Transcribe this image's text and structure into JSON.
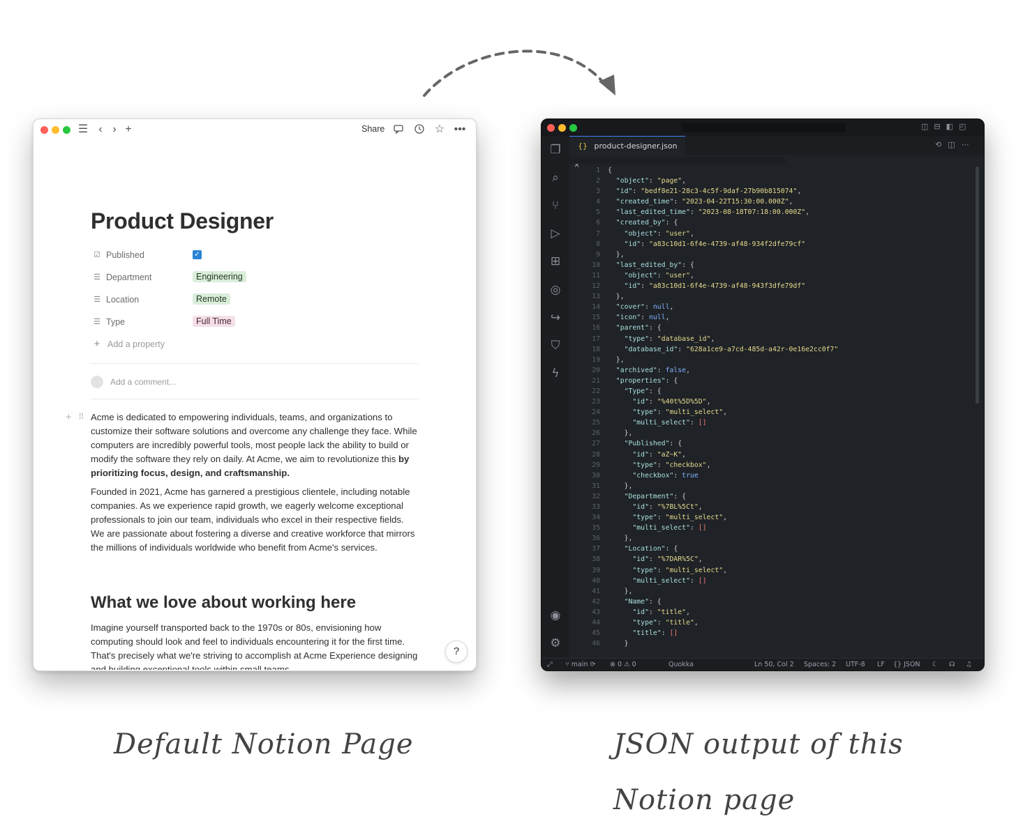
{
  "notion": {
    "toolbar": {
      "share_label": "Share"
    },
    "title": "Product Designer",
    "properties": [
      {
        "label": "Published",
        "icon": "checkbox-icon",
        "checked": true
      },
      {
        "label": "Department",
        "icon": "list-icon",
        "value": "Engineering",
        "color": "#dbeddb"
      },
      {
        "label": "Location",
        "icon": "list-icon",
        "value": "Remote",
        "color": "#dbeddb"
      },
      {
        "label": "Type",
        "icon": "list-icon",
        "value": "Full Time",
        "color": "#f5e0e9"
      }
    ],
    "add_property": "Add a property",
    "comment_placeholder": "Add a comment...",
    "paragraph1": "Acme is dedicated to empowering individuals, teams, and organizations to customize their software solutions and overcome any challenge they face. While computers are incredibly powerful tools, most people lack the ability to build or modify the software they rely on daily. At Acme, we aim to revolutionize this ",
    "paragraph1_bold": "by prioritizing focus, design, and craftsmanship.",
    "paragraph2": "Founded in 2021, Acme has garnered a prestigious clientele, including notable companies. As we experience rapid growth, we eagerly welcome exceptional professionals to join our team, individuals who excel in their respective fields. We are passionate about fostering a diverse and creative workforce that mirrors the millions of individuals worldwide who benefit from Acme's services.",
    "heading": "What we love about working here",
    "paragraph3": "Imagine yourself transported back to the 1970s or 80s, envisioning how computing should look and feel to individuals encountering it for the first time. That's precisely what we're striving to accomplish at Acme Experience designing and building exceptional tools within small teams",
    "help_label": "?"
  },
  "vscode": {
    "tab_label": "product-designer.json",
    "tab_icon": "{}",
    "status": {
      "branch": "main",
      "problems": "⊗ 0 ⚠ 0",
      "extension": "Quokka",
      "position": "Ln 50, Col 2",
      "spaces": "Spaces: 2",
      "encoding": "UTF-8",
      "eol": "LF",
      "language": "{} JSON"
    }
  },
  "captions": {
    "left": "Default Notion Page",
    "right_line1": "JSON output of this",
    "right_line2": "Notion page"
  }
}
